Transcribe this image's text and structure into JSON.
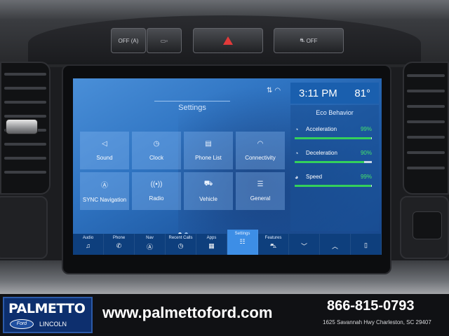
{
  "hard_buttons": {
    "auto_start_stop": "OFF (A)",
    "camera_label": "",
    "hazard_label": "",
    "traction_off": "OFF"
  },
  "status_bar": {
    "time": "3:11 PM",
    "temperature": "81°"
  },
  "settings": {
    "title": "Settings",
    "tiles": [
      {
        "label": "Sound",
        "icon": "speaker-icon"
      },
      {
        "label": "Clock",
        "icon": "clock-icon"
      },
      {
        "label": "Phone List",
        "icon": "phone-list-icon"
      },
      {
        "label": "Connectivity",
        "icon": "wifi-icon"
      },
      {
        "label": "SYNC Navigation",
        "icon": "navigation-icon"
      },
      {
        "label": "Radio",
        "icon": "radio-icon"
      },
      {
        "label": "Vehicle",
        "icon": "vehicle-icon"
      },
      {
        "label": "General",
        "icon": "sliders-icon"
      }
    ],
    "page_count": 2,
    "current_page": 1
  },
  "eco": {
    "title": "Eco Behavior",
    "rows": [
      {
        "label": "Acceleration",
        "value": "99%",
        "fraction": 0.99
      },
      {
        "label": "Deceleration",
        "value": "90%",
        "fraction": 0.9
      },
      {
        "label": "Speed",
        "value": "99%",
        "fraction": 0.99
      }
    ]
  },
  "nav": {
    "items": [
      {
        "label": "Audio",
        "icon": "music-note-icon"
      },
      {
        "label": "Phone",
        "icon": "phone-icon"
      },
      {
        "label": "Nav",
        "icon": "nav-icon"
      },
      {
        "label": "Recent Calls",
        "icon": "recent-calls-icon"
      },
      {
        "label": "Apps",
        "icon": "apps-grid-icon"
      },
      {
        "label": "Settings",
        "icon": "settings-icon",
        "active": true
      },
      {
        "label": "Features",
        "icon": "car-icon"
      },
      {
        "label": "",
        "icon": "chevron-down-icon"
      },
      {
        "label": "",
        "icon": "chevron-up-icon"
      },
      {
        "label": "",
        "icon": "phone-device-icon"
      }
    ]
  },
  "banner": {
    "logo_main": "PALMETTO",
    "logo_oval": "Ford",
    "logo_sub": "LINCOLN",
    "url": "www.palmettoford.com",
    "phone": "866-815-0793",
    "address": "1625 Savannah Hwy Charleston, SC 29407"
  },
  "colors": {
    "screen_blue": "#2f74c2",
    "eco_green": "#44e36b",
    "hazard_red": "#e23a3a",
    "nav_active": "#3d8ee6"
  }
}
